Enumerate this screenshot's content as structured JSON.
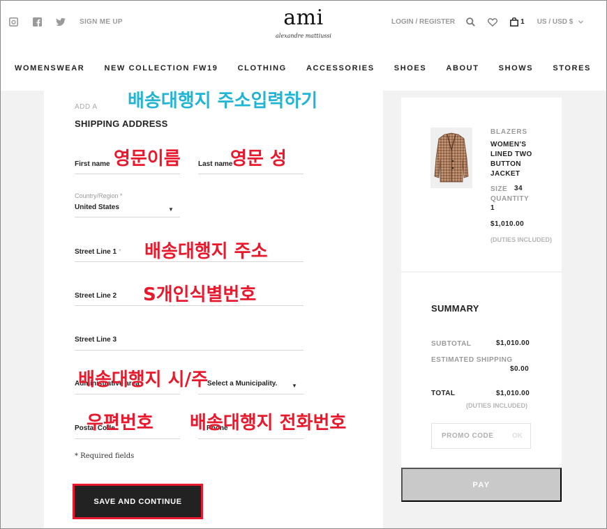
{
  "header": {
    "social": {
      "instagram_icon": "instagram-icon",
      "facebook_icon": "facebook-icon",
      "twitter_icon": "twitter-icon",
      "signup": "SIGN ME UP"
    },
    "brand": {
      "name": "ami",
      "subtitle": "alexandre mattiussi"
    },
    "login": "LOGIN / REGISTER",
    "cart_count": "1",
    "currency": "US / USD $"
  },
  "nav": [
    "WOMENSWEAR",
    "NEW COLLECTION FW19",
    "CLOTHING",
    "ACCESSORIES",
    "SHOES",
    "ABOUT",
    "SHOWS",
    "STORES"
  ],
  "form": {
    "add_a": "ADD A",
    "title": "SHIPPING ADDRESS",
    "first_name": "First name",
    "last_name": "Last name",
    "country_label": "Country/Region",
    "country_value": "United States",
    "street1": "Street Line 1",
    "street2": "Street Line 2",
    "street3": "Street Line 3",
    "admin_area": "Administrative area",
    "municipality": "Select a Municipality.",
    "postal": "Postal Code",
    "phone": "Phone",
    "required_note": "* Required fields",
    "save_button": "SAVE AND CONTINUE"
  },
  "annotations": {
    "title_note": "배송대행지 주소입력하기",
    "first_name_note": "영문이름",
    "last_name_note": "영문 성",
    "street1_note": "배송대행지 주소",
    "street2_note": "S개인식별번호",
    "city_state_note": "배송대행지 시/주",
    "postal_note": "우편번호",
    "phone_note": "배송대행지 전화번호"
  },
  "cart_item": {
    "category": "BLAZERS",
    "name_lines": [
      "WOMEN'S",
      "LINED TWO",
      "BUTTON",
      "JACKET"
    ],
    "size_label": "SIZE",
    "size_value": "34",
    "quantity_label": "QUANTITY",
    "quantity_value": "1",
    "price": "$1,010.00",
    "duties": "(DUTIES INCLUDED)"
  },
  "summary": {
    "title": "SUMMARY",
    "subtotal_label": "SUBTOTAL",
    "subtotal_value": "$1,010.00",
    "shipping_label": "ESTIMATED SHIPPING",
    "shipping_value": "$0.00",
    "total_label": "TOTAL",
    "total_value": "$1,010.00",
    "total_duties": "(DUTIES INCLUDED)",
    "promo_placeholder": "PROMO CODE",
    "promo_ok": "OK",
    "pay_button": "PAY"
  },
  "colors": {
    "accent_red": "#e8192c",
    "annotation_cyan": "#22b4d4",
    "dark": "#222222"
  }
}
